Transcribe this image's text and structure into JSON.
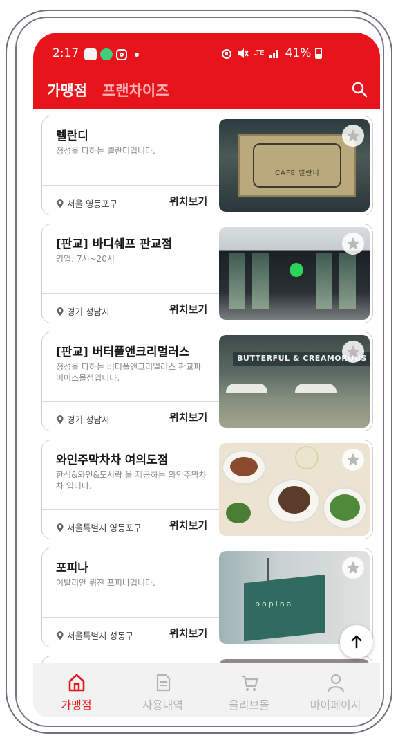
{
  "status_bar": {
    "time": "2:17",
    "network": "LTE",
    "battery": "41%"
  },
  "header": {
    "tabs": [
      {
        "label": "가맹점",
        "active": true
      },
      {
        "label": "프랜차이즈",
        "active": false
      }
    ],
    "search_icon": "search-icon"
  },
  "stores": [
    {
      "name": "렐란디",
      "description": "정성을 다하는 렐란디입니다.",
      "location": "서울 영등포구",
      "map_label": "위치보기",
      "photo_sign": "CAFE 렐란디"
    },
    {
      "name": "[판교] 바디쉐프 판교점",
      "description": "영업: 7시~20시",
      "location": "경기 성남시",
      "map_label": "위치보기"
    },
    {
      "name": "[판교] 버터풀앤크리멀러스",
      "description": "정성을 다하는 버터풀앤크리멀러스 판교파미어스몰점입니다.",
      "location": "경기 성남시",
      "map_label": "위치보기",
      "photo_sign": "BUTTERFUL & CREAMOROUS"
    },
    {
      "name": "와인주막차차 여의도점",
      "description": "한식&와인&도시락 을 제공하는 와인주막차차 입니다.",
      "location": "서울특별시 영등포구",
      "map_label": "위치보기"
    },
    {
      "name": "포피나",
      "description": "이탈리안 퀴진 포피나입니다.",
      "location": "서울특별시 성동구",
      "map_label": "위치보기",
      "photo_sign": "popina"
    }
  ],
  "bottom_nav": [
    {
      "label": "가맹점",
      "icon": "home-icon",
      "active": true
    },
    {
      "label": "사용내역",
      "icon": "document-icon",
      "active": false
    },
    {
      "label": "올리브몰",
      "icon": "cart-icon",
      "active": false
    },
    {
      "label": "마이페이지",
      "icon": "person-icon",
      "active": false
    }
  ],
  "colors": {
    "brand_red": "#e8141c",
    "inactive_gray": "#b4b4b4"
  }
}
